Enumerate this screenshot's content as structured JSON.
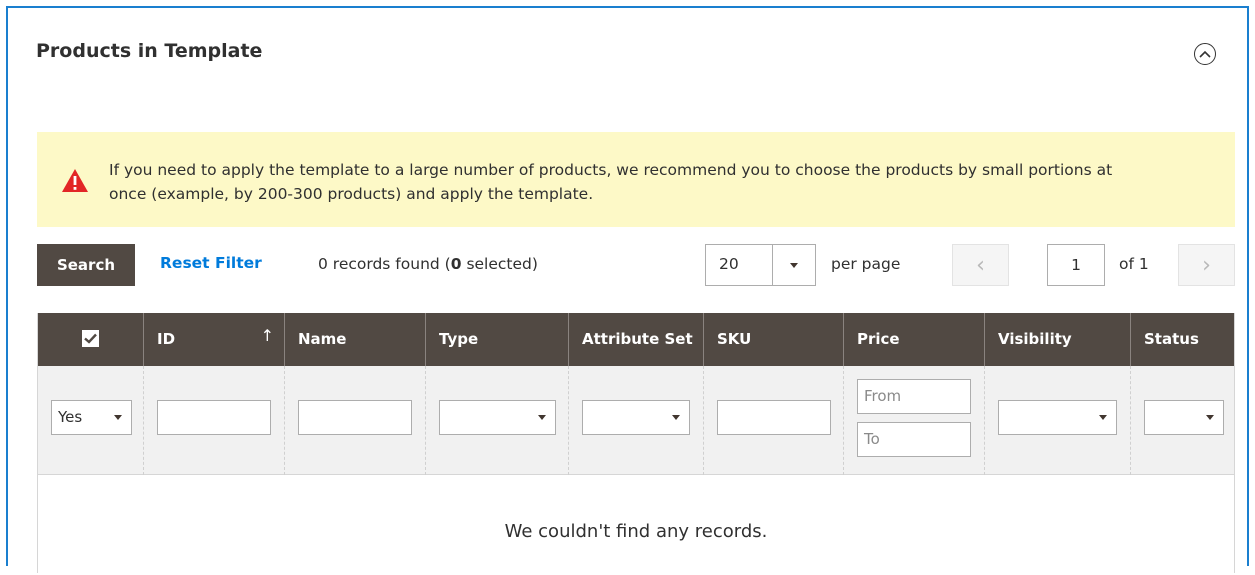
{
  "section": {
    "title": "Products in Template"
  },
  "notice": {
    "text": "If you need to apply the template to a large number of products, we recommend you to choose the products by small portions at once (example, by 200-300 products) and apply the template."
  },
  "toolbar": {
    "search_label": "Search",
    "reset_label": "Reset Filter",
    "records_prefix": "0 records found (",
    "records_selected": "0",
    "records_suffix": " selected)",
    "per_page_value": "20",
    "per_page_label": "per page",
    "page_current": "1",
    "page_of": "of 1",
    "prev_glyph": "‹",
    "next_glyph": "›"
  },
  "grid": {
    "columns": [
      "ID",
      "Name",
      "Type",
      "Attribute Set",
      "SKU",
      "Price",
      "Visibility",
      "Status"
    ],
    "id_sort_glyph": "↑",
    "filters": {
      "select_value": "Yes",
      "price_from_placeholder": "From",
      "price_to_placeholder": "To"
    },
    "empty_message": "We couldn't find any records."
  },
  "colors": {
    "header_bg": "#514943",
    "accent_link": "#007bdb",
    "notice_bg": "#fdf9c7",
    "warning_icon": "#e22626",
    "frame_border": "#1a7fcf"
  },
  "icons": {
    "collapse": "chevron-up-circle-icon",
    "warning": "warning-triangle-icon",
    "checkbox": "checkbox-checked-icon"
  }
}
